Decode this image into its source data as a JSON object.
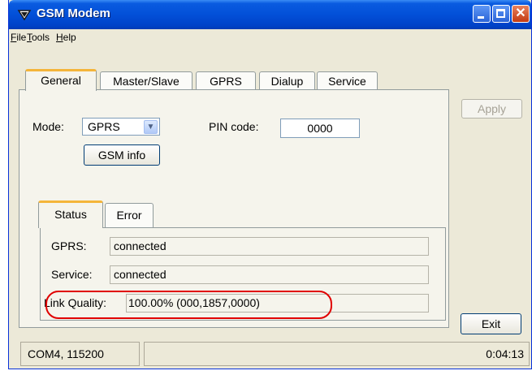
{
  "window": {
    "title": "GSM Modem",
    "icon": "antenna-icon",
    "controls": {
      "minimize": "minimize-icon",
      "maximize": "maximize-icon",
      "close": "close-icon"
    }
  },
  "menu": [
    "File",
    "Tools",
    "Help"
  ],
  "tabs": [
    "General",
    "Master/Slave",
    "GPRS",
    "Dialup",
    "Service"
  ],
  "active_tab": "General",
  "general": {
    "mode_label": "Mode:",
    "mode_value": "GPRS",
    "pin_label": "PIN code:",
    "pin_value": "0000",
    "gsm_info_button": "GSM info"
  },
  "subtabs": [
    "Status",
    "Error"
  ],
  "active_subtab": "Status",
  "status": {
    "gprs_label": "GPRS:",
    "gprs_value": "connected",
    "service_label": "Service:",
    "service_value": "connected",
    "link_quality_label": "Link Quality:",
    "link_quality_value": "100.00% (000,1857,0000)"
  },
  "buttons": {
    "apply": "Apply",
    "exit": "Exit"
  },
  "statusbar": {
    "port": "COM4, 115200",
    "middle": "",
    "time": "0:04:13"
  },
  "colors": {
    "title_bar": "#0250d8",
    "highlight": "#e00000",
    "active_tab_accent": "#f4b53a"
  }
}
